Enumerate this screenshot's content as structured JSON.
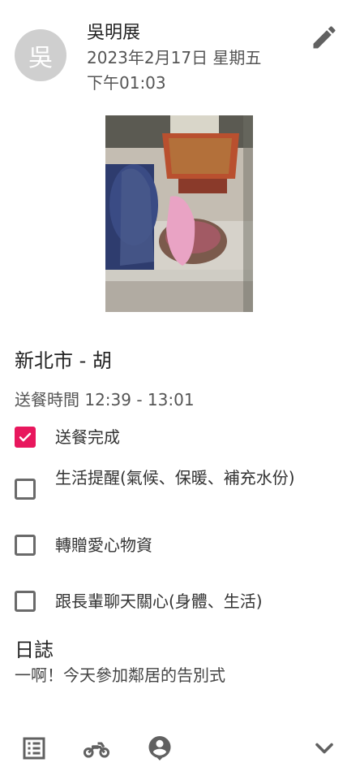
{
  "header": {
    "avatar_initial": "吳",
    "author_name": "吳明展",
    "date_line1": "2023年2月17日 星期五",
    "date_line2": "下午01:03",
    "edit_icon": "pencil-icon"
  },
  "record": {
    "location": "新北市 - 胡",
    "delivery_time": "送餐時間 12:39 - 13:01"
  },
  "checklist": [
    {
      "label": "送餐完成",
      "checked": true
    },
    {
      "label": "生活提醒(氣候、保暖、補充水份)",
      "checked": false
    },
    {
      "label": "轉贈愛心物資",
      "checked": false
    },
    {
      "label": "跟長輩聊天關心(身體、生活)",
      "checked": false
    }
  ],
  "log": {
    "title": "日誌",
    "text": "一啊！今天參加鄰居的告別式"
  },
  "bottom_nav": {
    "icons": [
      "list-icon",
      "motorcycle-icon",
      "person-pin-icon",
      "chevron-down-icon"
    ]
  },
  "colors": {
    "accent": "#e8175d",
    "avatar_bg": "#cfcfcf"
  }
}
